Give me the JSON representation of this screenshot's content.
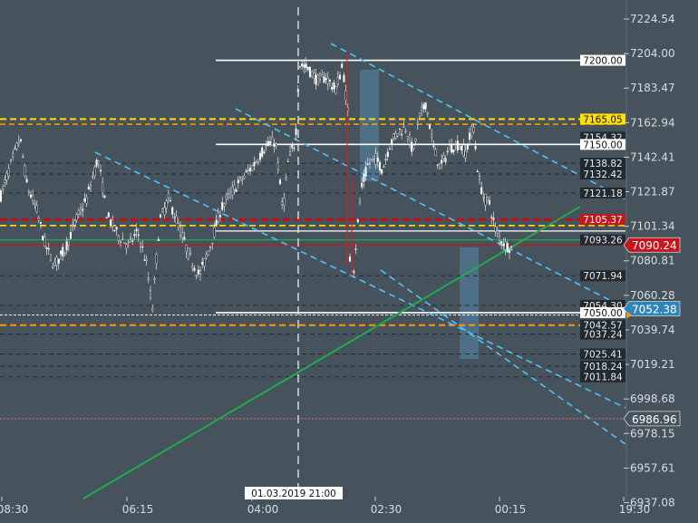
{
  "chart_data": {
    "type": "candlestick",
    "y_axis": {
      "ticks": [
        7224.54,
        7204.0,
        7183.47,
        7162.94,
        7142.41,
        7121.87,
        7101.34,
        7080.81,
        7060.28,
        7039.74,
        7019.21,
        6998.68,
        6978.15,
        6957.61,
        6937.08
      ],
      "range": [
        6937.08,
        7224.54
      ],
      "position": "right"
    },
    "x_axis": {
      "tick_labels": [
        "08:30",
        "06:15",
        "04:00",
        "02:30",
        "00:15",
        "19:30"
      ]
    },
    "crosshair": {
      "time_label": "01.03.2019 21:00"
    },
    "price_flags": [
      {
        "value": "7090.24",
        "color": "#c4161c",
        "text_color": "#ffffff"
      },
      {
        "value": "7052.38",
        "color": "#2e86b8",
        "text_color": "#ffffff"
      },
      {
        "value": "6986.96",
        "color": "#47535c",
        "text_color": "#ffffff"
      }
    ],
    "level_labels": [
      {
        "value": "7200.00",
        "style": "white"
      },
      {
        "value": "7165.05",
        "style": "yellow"
      },
      {
        "value": "7154.32",
        "style": "dark"
      },
      {
        "value": "7150.00",
        "style": "white"
      },
      {
        "value": "7138.82",
        "style": "dark"
      },
      {
        "value": "7132.42",
        "style": "dark"
      },
      {
        "value": "7121.18",
        "style": "dark"
      },
      {
        "value": "7105.37",
        "style": "red"
      },
      {
        "value": "7093.26",
        "style": "dark"
      },
      {
        "value": "7071.94",
        "style": "dark"
      },
      {
        "value": "7054.30",
        "style": "dark"
      },
      {
        "value": "7050.00",
        "style": "white"
      },
      {
        "value": "7042.57",
        "style": "dark"
      },
      {
        "value": "7037.24",
        "style": "dark"
      },
      {
        "value": "7025.41",
        "style": "dark"
      },
      {
        "value": "7018.24",
        "style": "dark"
      },
      {
        "value": "7011.84",
        "style": "dark"
      }
    ],
    "colors": {
      "background": "#47535c",
      "candle": "#ffffff",
      "support_resistance": "#d7d7d7",
      "yellow_level": "#ffe000",
      "orange_level": "#ff9800",
      "red_level": "#e00000",
      "channel": "#4fc3f7",
      "trendline": "#1faa4f"
    }
  }
}
